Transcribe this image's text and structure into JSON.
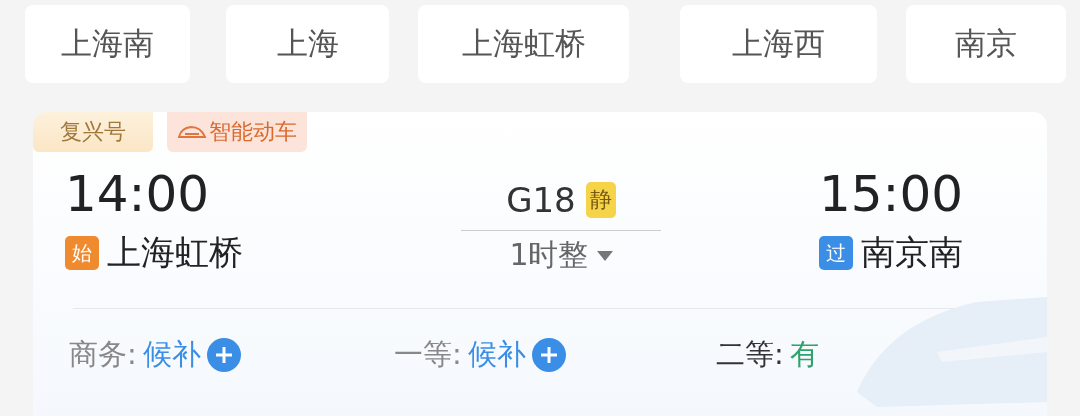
{
  "stations": [
    {
      "name": "上海南"
    },
    {
      "name": "上海"
    },
    {
      "name": "上海虹桥"
    },
    {
      "name": "上海西"
    },
    {
      "name": "南京"
    }
  ],
  "train": {
    "tags": [
      {
        "text": "复兴号",
        "kind": "brand"
      },
      {
        "text": "智能动车",
        "kind": "smart"
      }
    ],
    "departure": {
      "time": "14:00",
      "station": "上海虹桥",
      "badge": {
        "text": "始",
        "kind": "origin"
      }
    },
    "number": "G18",
    "quiet_badge": "静",
    "duration": "1时整",
    "arrival": {
      "time": "15:00",
      "station": "南京南",
      "badge": {
        "text": "过",
        "kind": "passing"
      }
    },
    "seats": [
      {
        "class": "商务:",
        "status": "候补",
        "kind": "waitlist"
      },
      {
        "class": "一等:",
        "status": "候补",
        "kind": "waitlist"
      },
      {
        "class": "二等:",
        "status": "有",
        "kind": "available"
      }
    ]
  }
}
